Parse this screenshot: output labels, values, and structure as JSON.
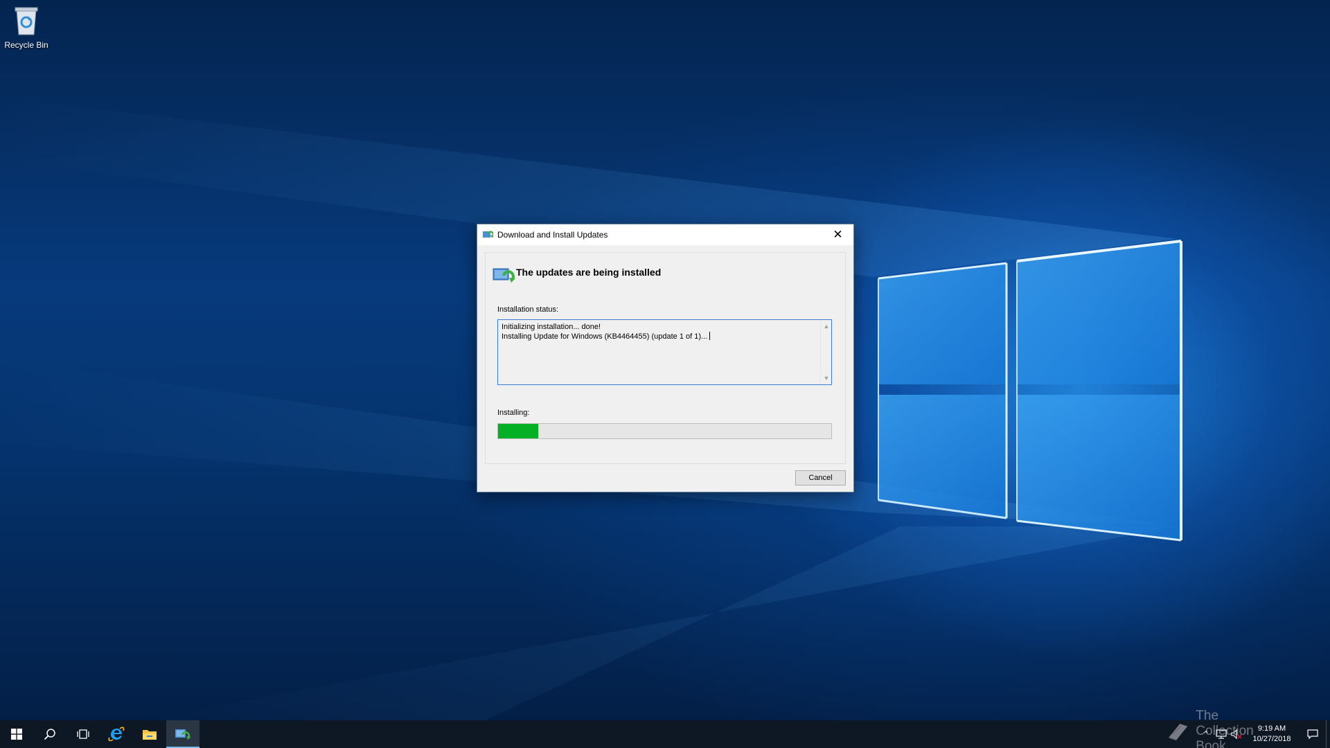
{
  "desktop": {
    "recycle_bin_label": "Recycle Bin"
  },
  "dialog": {
    "title": "Download and Install Updates",
    "close_glyph": "✕",
    "heading": "The updates are being installed",
    "status_label": "Installation status:",
    "status_lines": [
      "Initializing installation... done!",
      "Installing Update for Windows (KB4464455) (update 1 of 1)..."
    ],
    "installing_label": "Installing:",
    "progress_fraction": 0.12,
    "cancel_label": "Cancel"
  },
  "taskbar": {
    "items": [
      "start-icon",
      "search-icon",
      "task-view-icon",
      "internet-explorer-icon",
      "file-explorer-icon",
      "windows-update-icon"
    ],
    "active_item": "windows-update-icon",
    "watermark": "The Collection Book",
    "clock_time": "9:19 AM",
    "clock_date": "10/27/2018"
  },
  "colors": {
    "progress_green": "#06b025",
    "focus_border": "#3a7bd5",
    "taskbar": "#0e1724",
    "accent": "#76b9ed"
  }
}
